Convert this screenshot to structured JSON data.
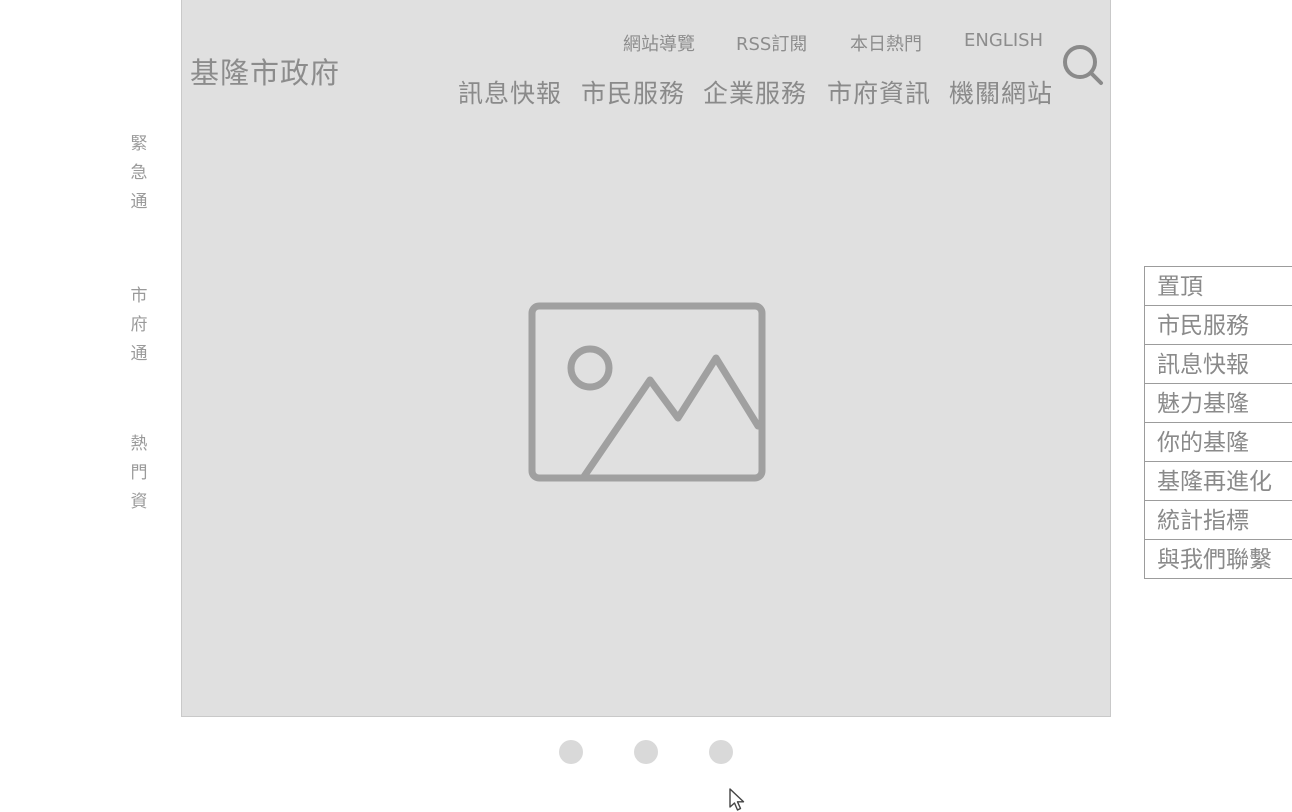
{
  "header": {
    "site_title": "基隆市政府",
    "utility_links": [
      "網站導覽",
      "RSS訂閱",
      "本日熱門",
      "ENGLISH"
    ],
    "main_nav": [
      "訊息快報",
      "市民服務",
      "企業服務",
      "市府資訊",
      "機關網站"
    ]
  },
  "left_rail": [
    [
      "緊",
      "急",
      "通"
    ],
    [
      "市",
      "府",
      "通"
    ],
    [
      "熱",
      "門",
      "資"
    ]
  ],
  "right_nav": [
    "置頂",
    "市民服務",
    "訊息快報",
    "魅力基隆",
    "你的基隆",
    "基隆再進化",
    "統計指標",
    "與我們聯繫"
  ],
  "carousel": {
    "slide_count": 3
  },
  "colors": {
    "hero_bg": "#e0e0e0",
    "text": "#8a8a8a",
    "icon": "#a0a0a0",
    "dot": "#d9d9d9"
  },
  "icons": {
    "search": "search-icon",
    "image": "image-placeholder-icon"
  }
}
